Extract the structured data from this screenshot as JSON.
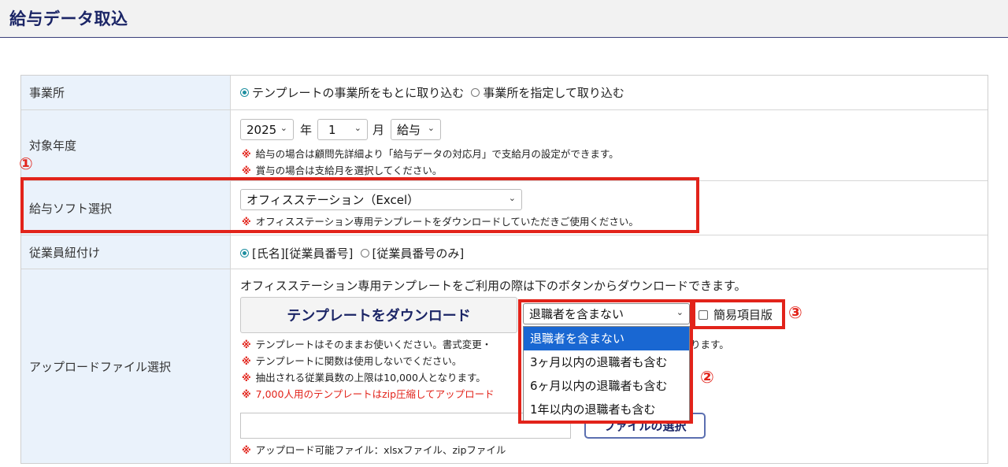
{
  "page_title": "給与データ取込",
  "office": {
    "label": "事業所",
    "opt_template": "テンプレートの事業所をもとに取り込む",
    "opt_specify": "事業所を指定して取り込む"
  },
  "period": {
    "label": "対象年度",
    "year": "2025",
    "year_unit": "年",
    "month": "1",
    "month_unit": "月",
    "type": "給与",
    "note1": "給与の場合は顧問先詳細より「給与データの対応月」で支給月の設定ができます。",
    "note2": "賞与の場合は支給月を選択してください。"
  },
  "software": {
    "label": "給与ソフト選択",
    "selected": "オフィスステーション（Excel）",
    "note": "オフィスステーション専用テンプレートをダウンロードしていただきご使用ください。"
  },
  "employee_link": {
    "label": "従業員紐付け",
    "opt_name_number": "[氏名][従業員番号]",
    "opt_number_only": "[従業員番号のみ]"
  },
  "upload": {
    "label": "アップロードファイル選択",
    "intro": "オフィスステーション専用テンプレートをご利用の際は下のボタンからダウンロードできます。",
    "download_button": "テンプレートをダウンロード",
    "retired_select": "退職者を含まない",
    "retired_options": [
      "退職者を含まない",
      "3ヶ月以内の退職者も含む",
      "6ヶ月以内の退職者も含む",
      "1年以内の退職者も含む"
    ],
    "simple_checkbox": "簡易項目版",
    "note1a": "テンプレートはそのままお使いください。書式変更・",
    "note1b": "ります。",
    "note2": "テンプレートに関数は使用しないでください。",
    "note3": "抽出される従業員数の上限は10,000人となります。",
    "note4": "7,000人用のテンプレートはzip圧縮してアップロード",
    "file_button": "ファイルの選択",
    "file_note": "アップロード可能ファイル：xlsxファイル、zipファイル"
  },
  "note_mark": "※",
  "markers": {
    "one": "①",
    "two": "②",
    "three": "③"
  },
  "colors": {
    "accent_red": "#e2231a",
    "title_navy": "#1b2566",
    "label_bg": "#eaf2fb",
    "highlight_blue": "#1967d2"
  }
}
